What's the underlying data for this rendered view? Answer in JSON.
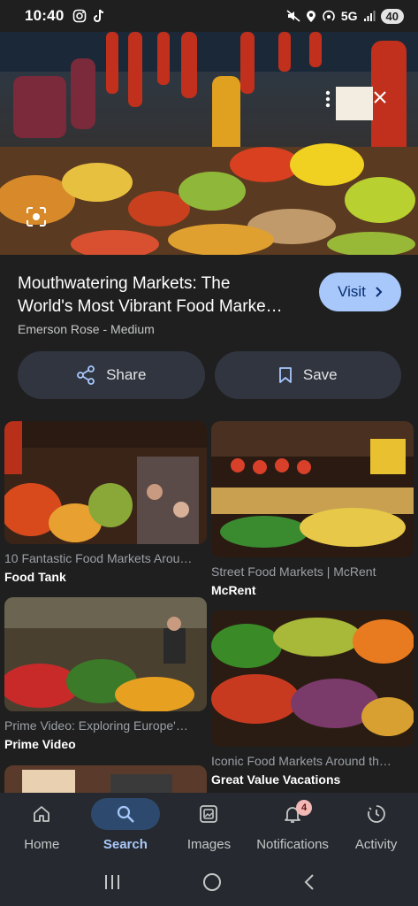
{
  "status": {
    "time": "10:40",
    "network": "5G",
    "battery": "40"
  },
  "result": {
    "title_line1": "Mouthwatering Markets: The",
    "title_line2": "World's Most Vibrant Food Marke…",
    "source": "Emerson Rose - Medium",
    "visit_label": "Visit"
  },
  "actions": {
    "share_label": "Share",
    "save_label": "Save"
  },
  "related": [
    {
      "caption": "10 Fantastic Food Markets Arou…",
      "source": "Food Tank"
    },
    {
      "caption": "Street Food Markets | McRent",
      "source": "McRent"
    },
    {
      "caption": "Prime Video: Exploring Europe'…",
      "source": "Prime Video"
    },
    {
      "caption": "Iconic Food Markets Around th…",
      "source": "Great Value Vacations"
    }
  ],
  "nav": {
    "items": [
      {
        "label": "Home",
        "icon": "home-icon"
      },
      {
        "label": "Search",
        "icon": "search-icon"
      },
      {
        "label": "Images",
        "icon": "images-icon"
      },
      {
        "label": "Notifications",
        "icon": "bell-icon"
      },
      {
        "label": "Activity",
        "icon": "activity-icon"
      }
    ],
    "active": "Search",
    "notification_count": "4"
  },
  "colors": {
    "accent": "#a8c7fa",
    "background": "#1f1f1f",
    "button_bg": "#303540",
    "nav_bg": "#262a30"
  }
}
